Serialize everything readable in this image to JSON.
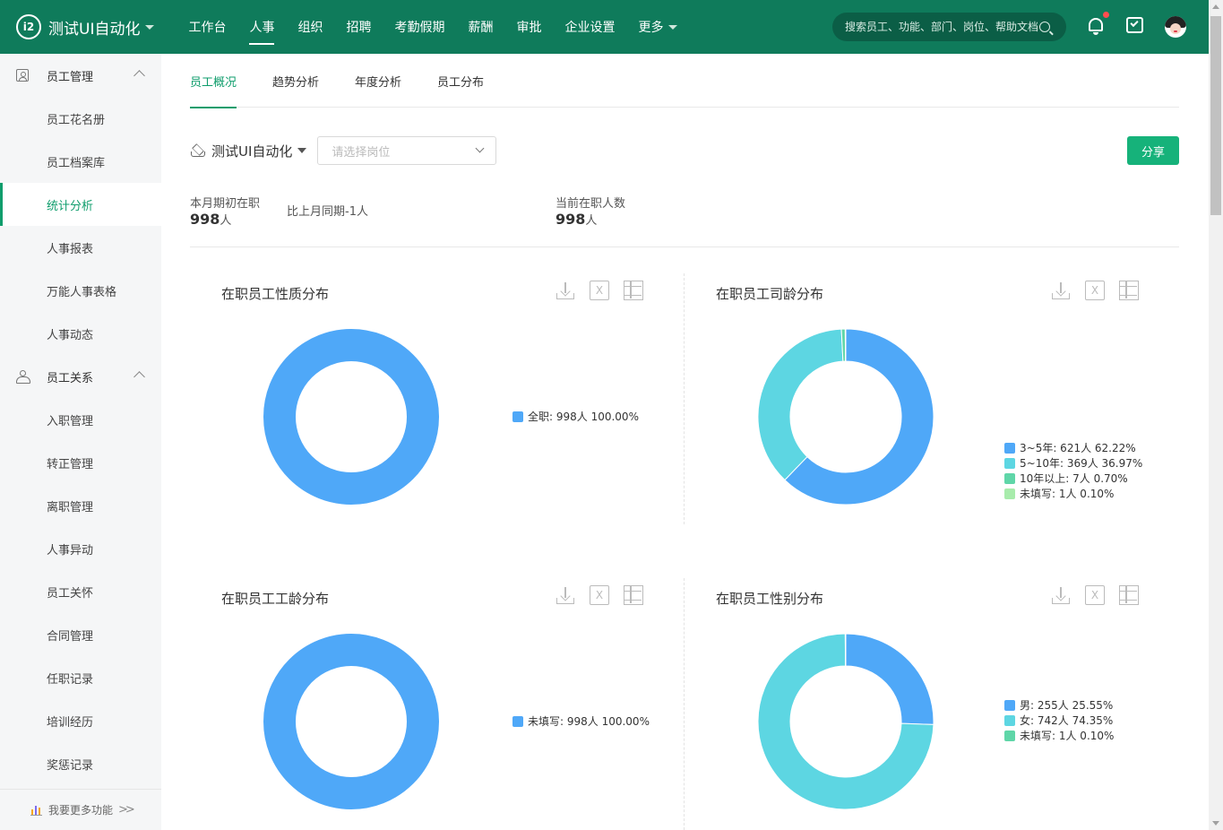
{
  "header": {
    "logo_text": "i2",
    "org_name": "测试UI自动化",
    "nav": [
      "工作台",
      "人事",
      "组织",
      "招聘",
      "考勤假期",
      "薪酬",
      "审批",
      "企业设置",
      "更多"
    ],
    "active_nav": 1,
    "search_placeholder": "搜索员工、功能、部门、岗位、帮助文档"
  },
  "sidebar": {
    "group1": "员工管理",
    "group1_items": [
      "员工花名册",
      "员工档案库",
      "统计分析",
      "人事报表",
      "万能人事表格",
      "人事动态"
    ],
    "group2": "员工关系",
    "group2_items": [
      "入职管理",
      "转正管理",
      "离职管理",
      "人事异动",
      "员工关怀",
      "合同管理",
      "任职记录",
      "培训经历",
      "奖惩记录"
    ],
    "active_item": "统计分析",
    "footer": "我要更多功能"
  },
  "tabs": [
    "员工概况",
    "趋势分析",
    "年度分析",
    "员工分布"
  ],
  "filter": {
    "org": "测试UI自动化",
    "post_placeholder": "请选择岗位",
    "share": "分享"
  },
  "stats": {
    "month_start_label": "本月期初在职",
    "month_start_value": "998",
    "unit": "人",
    "compare": "比上月同期-1人",
    "current_label": "当前在职人数",
    "current_value": "998"
  },
  "colors": {
    "brand": "#0f7b5b",
    "accent": "#0f9d6c",
    "blue": "#4fa8f8",
    "cyan": "#5dd6e2",
    "green": "#5fd6a8",
    "light_green": "#a8ecac"
  },
  "chart_data": [
    {
      "type": "pie",
      "title": "在职员工性质分布",
      "slices": [
        {
          "label": "全职: 998人 100.00%",
          "value": 998,
          "color": "#4fa8f8"
        }
      ]
    },
    {
      "type": "pie",
      "title": "在职员工司龄分布",
      "slices": [
        {
          "label": "3~5年: 621人 62.22%",
          "value": 621,
          "color": "#4fa8f8"
        },
        {
          "label": "5~10年: 369人 36.97%",
          "value": 369,
          "color": "#5dd6e2"
        },
        {
          "label": "10年以上: 7人 0.70%",
          "value": 7,
          "color": "#5fd6a8"
        },
        {
          "label": "未填写: 1人 0.10%",
          "value": 1,
          "color": "#a8ecac"
        }
      ]
    },
    {
      "type": "pie",
      "title": "在职员工工龄分布",
      "slices": [
        {
          "label": "未填写: 998人 100.00%",
          "value": 998,
          "color": "#4fa8f8"
        }
      ]
    },
    {
      "type": "pie",
      "title": "在职员工性别分布",
      "slices": [
        {
          "label": "男: 255人 25.55%",
          "value": 255,
          "color": "#4fa8f8"
        },
        {
          "label": "女: 742人 74.35%",
          "value": 742,
          "color": "#5dd6e2"
        },
        {
          "label": "未填写: 1人 0.10%",
          "value": 1,
          "color": "#5fd6a8"
        }
      ]
    }
  ]
}
